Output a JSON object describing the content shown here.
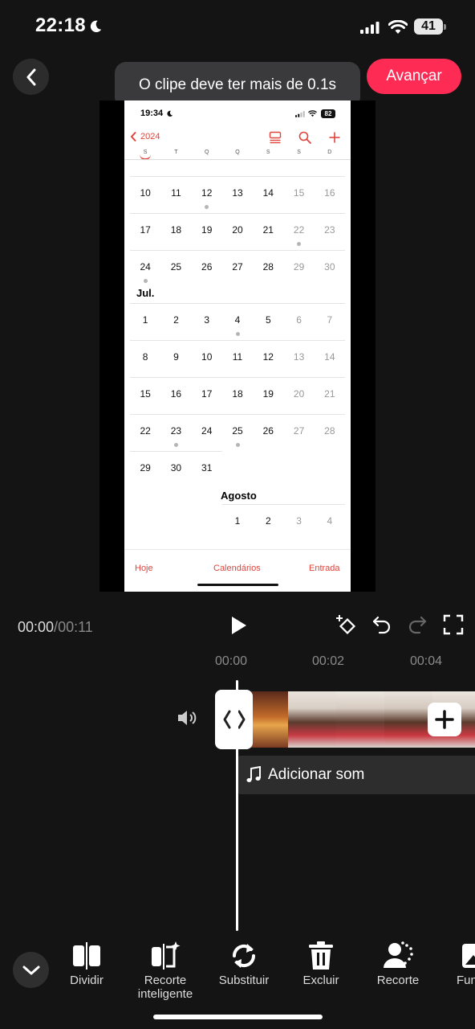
{
  "status_bar": {
    "time": "22:18",
    "battery": "41"
  },
  "header": {
    "toast": "O clipe deve ter mais de 0.1s",
    "next_label": "Avançar"
  },
  "preview": {
    "status_time": "19:34",
    "battery": "82",
    "year_back": "2024",
    "weekdays": [
      "S",
      "T",
      "Q",
      "Q",
      "S",
      "S",
      "D"
    ],
    "june_weeks": [
      {
        "days": [
          "10",
          "11",
          "12",
          "13",
          "14",
          "15",
          "16"
        ],
        "dots": [
          2
        ]
      },
      {
        "days": [
          "17",
          "18",
          "19",
          "20",
          "21",
          "22",
          "23"
        ],
        "dots": [
          5
        ]
      },
      {
        "days": [
          "24",
          "25",
          "26",
          "27",
          "28",
          "29",
          "30"
        ],
        "dots": [
          0
        ]
      }
    ],
    "july_label": "Jul.",
    "july_weeks": [
      {
        "days": [
          "1",
          "2",
          "3",
          "4",
          "5",
          "6",
          "7"
        ],
        "dots": [
          3
        ]
      },
      {
        "days": [
          "8",
          "9",
          "10",
          "11",
          "12",
          "13",
          "14"
        ],
        "dots": []
      },
      {
        "days": [
          "15",
          "16",
          "17",
          "18",
          "19",
          "20",
          "21"
        ],
        "dots": []
      },
      {
        "days": [
          "22",
          "23",
          "24",
          "25",
          "26",
          "27",
          "28"
        ],
        "dots": [
          1,
          3
        ]
      },
      {
        "days": [
          "29",
          "30",
          "31"
        ],
        "dots": []
      }
    ],
    "august_label": "Agosto",
    "august_days": [
      "1",
      "2",
      "3",
      "4"
    ],
    "tabs": {
      "today": "Hoje",
      "calendars": "Calendários",
      "inbox": "Entrada"
    }
  },
  "playback": {
    "current": "00:00",
    "separator": "/",
    "total": "00:11"
  },
  "ruler": [
    "00:00",
    "00:02",
    "00:04"
  ],
  "timeline": {
    "add_sound": "Adicionar som"
  },
  "toolbar": {
    "items": [
      {
        "label": "Dividir",
        "icon": "split-icon"
      },
      {
        "label": "Recorte inteligente",
        "icon": "smart-cut-icon"
      },
      {
        "label": "Substituir",
        "icon": "replace-icon"
      },
      {
        "label": "Excluir",
        "icon": "trash-icon"
      },
      {
        "label": "Recorte",
        "icon": "cutout-icon"
      },
      {
        "label": "Fun",
        "icon": "background-icon"
      }
    ]
  },
  "colors": {
    "accent": "#fe2c55",
    "calendar_red": "#e0443d",
    "background": "#141414"
  }
}
